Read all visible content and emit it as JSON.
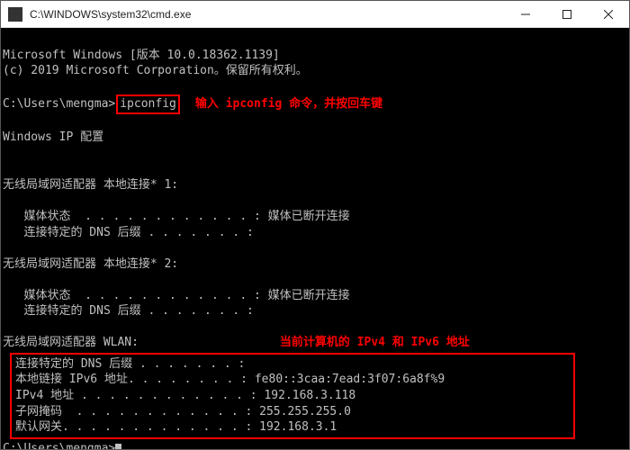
{
  "titlebar": {
    "icon_path": "C:\\WINDOWS\\system32\\cmd.exe",
    "title": "C:\\WINDOWS\\system32\\cmd.exe"
  },
  "header": {
    "line1": "Microsoft Windows [版本 10.0.18362.1139]",
    "line2": "(c) 2019 Microsoft Corporation。保留所有权利。"
  },
  "prompt1": {
    "prefix": "C:\\Users\\mengma>",
    "command": "ipconfig",
    "annotation": "输入 ipconfig 命令，并按回车键"
  },
  "ip_header": "Windows IP 配置",
  "adapters": [
    {
      "title": "无线局域网适配器 本地连接* 1:",
      "rows": [
        {
          "label": "媒体状态  . . . . . . . . . . . . :",
          "value": " 媒体已断开连接"
        },
        {
          "label": "连接特定的 DNS 后缀 . . . . . . . :",
          "value": ""
        }
      ]
    },
    {
      "title": "无线局域网适配器 本地连接* 2:",
      "rows": [
        {
          "label": "媒体状态  . . . . . . . . . . . . :",
          "value": " 媒体已断开连接"
        },
        {
          "label": "连接特定的 DNS 后缀 . . . . . . . :",
          "value": ""
        }
      ]
    }
  ],
  "wlan": {
    "title": "无线局域网适配器 WLAN:",
    "annotation": "当前计算机的 IPv4 和 IPv6 地址",
    "rows": [
      {
        "label": "连接特定的 DNS 后缀 . . . . . . . :",
        "value": ""
      },
      {
        "label": "本地链接 IPv6 地址. . . . . . . . :",
        "value": " fe80::3caa:7ead:3f07:6a8f%9"
      },
      {
        "label": "IPv4 地址 . . . . . . . . . . . . :",
        "value": " 192.168.3.118"
      },
      {
        "label": "子网掩码  . . . . . . . . . . . . :",
        "value": " 255.255.255.0"
      },
      {
        "label": "默认网关. . . . . . . . . . . . . :",
        "value": " 192.168.3.1"
      }
    ]
  },
  "prompt2": {
    "prefix": "C:\\Users\\mengma>"
  }
}
